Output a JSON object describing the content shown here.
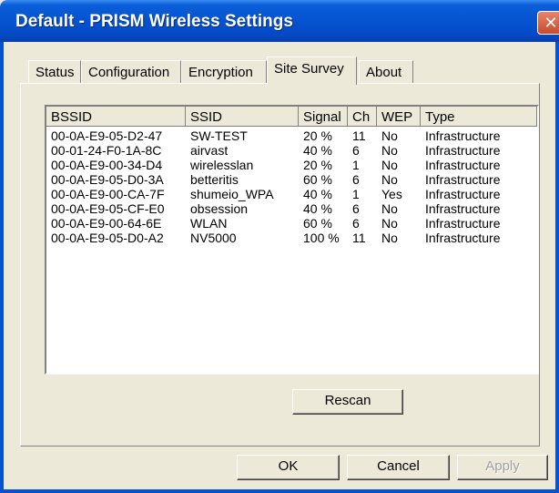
{
  "window": {
    "title": "Default - PRISM Wireless Settings",
    "close_glyph": "✕"
  },
  "tabs": [
    {
      "label": "Status"
    },
    {
      "label": "Configuration"
    },
    {
      "label": "Encryption"
    },
    {
      "label": "Site Survey"
    },
    {
      "label": "About"
    }
  ],
  "active_tab": "Site Survey",
  "table": {
    "columns": [
      "BSSID",
      "SSID",
      "Signal",
      "Ch",
      "WEP",
      "Type"
    ],
    "rows": [
      [
        "00-0A-E9-05-D2-47",
        "SW-TEST",
        "20 %",
        "11",
        "No",
        "Infrastructure"
      ],
      [
        "00-01-24-F0-1A-8C",
        "airvast",
        "40 %",
        "6",
        "No",
        "Infrastructure"
      ],
      [
        "00-0A-E9-00-34-D4",
        "wirelesslan",
        "20 %",
        "1",
        "No",
        "Infrastructure"
      ],
      [
        "00-0A-E9-05-D0-3A",
        "betteritis",
        "60 %",
        "6",
        "No",
        "Infrastructure"
      ],
      [
        "00-0A-E9-00-CA-7F",
        "shumeio_WPA",
        "40 %",
        "1",
        "Yes",
        "Infrastructure"
      ],
      [
        "00-0A-E9-05-CF-E0",
        "obsession",
        "40 %",
        "6",
        "No",
        "Infrastructure"
      ],
      [
        "00-0A-E9-00-64-6E",
        "WLAN",
        "60 %",
        "6",
        "No",
        "Infrastructure"
      ],
      [
        "00-0A-E9-05-D0-A2",
        "NV5000",
        "100 %",
        "11",
        "No",
        "Infrastructure"
      ]
    ]
  },
  "buttons": {
    "rescan": "Rescan",
    "ok": "OK",
    "cancel": "Cancel",
    "apply": "Apply"
  }
}
